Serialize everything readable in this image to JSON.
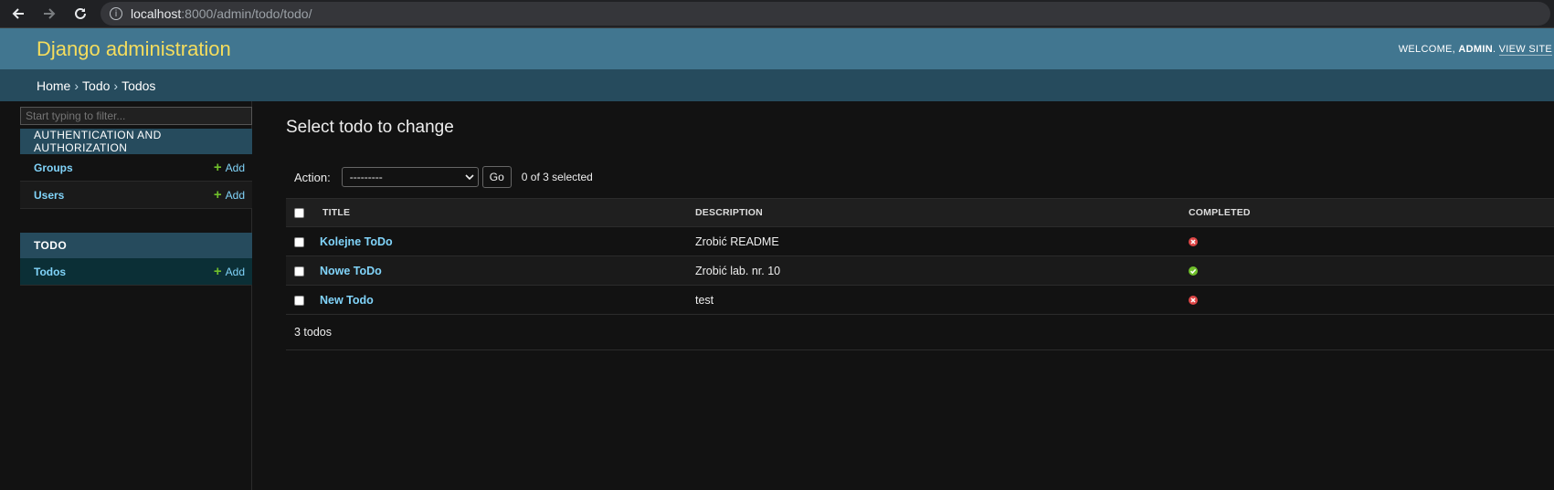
{
  "browser": {
    "url_host": "localhost",
    "url_path": ":8000/admin/todo/todo/"
  },
  "header": {
    "branding": "Django administration",
    "welcome": "WELCOME,",
    "user": "ADMIN",
    "sep": ". ",
    "view_site": "VIEW SITE"
  },
  "breadcrumbs": [
    "Home",
    "Todo",
    "Todos"
  ],
  "sidebar": {
    "filter_placeholder": "Start typing to filter...",
    "modules": [
      {
        "caption": "AUTHENTICATION AND AUTHORIZATION",
        "models": [
          {
            "name": "Groups",
            "add": "Add"
          },
          {
            "name": "Users",
            "add": "Add"
          }
        ]
      },
      {
        "caption": "TODO",
        "models": [
          {
            "name": "Todos",
            "add": "Add"
          }
        ]
      }
    ]
  },
  "content": {
    "title": "Select todo to change",
    "action_label": "Action:",
    "action_value": "---------",
    "go_label": "Go",
    "selected_counter": "0 of 3 selected",
    "columns": [
      "TITLE",
      "DESCRIPTION",
      "COMPLETED"
    ],
    "rows": [
      {
        "title": "Kolejne ToDo",
        "description": "Zrobić README",
        "completed": false
      },
      {
        "title": "Nowe ToDo",
        "description": "Zrobić lab. nr. 10",
        "completed": true
      },
      {
        "title": "New Todo",
        "description": "test",
        "completed": false
      }
    ],
    "paginator": "3 todos"
  },
  "colors": {
    "header_bg": "#417690",
    "branding": "#f5dd5d",
    "breadcrumbs_bg": "#264b5d",
    "link": "#81d4fa",
    "add_plus": "#70bf2b",
    "yes": "#70bf2b",
    "no": "#dd4646"
  }
}
